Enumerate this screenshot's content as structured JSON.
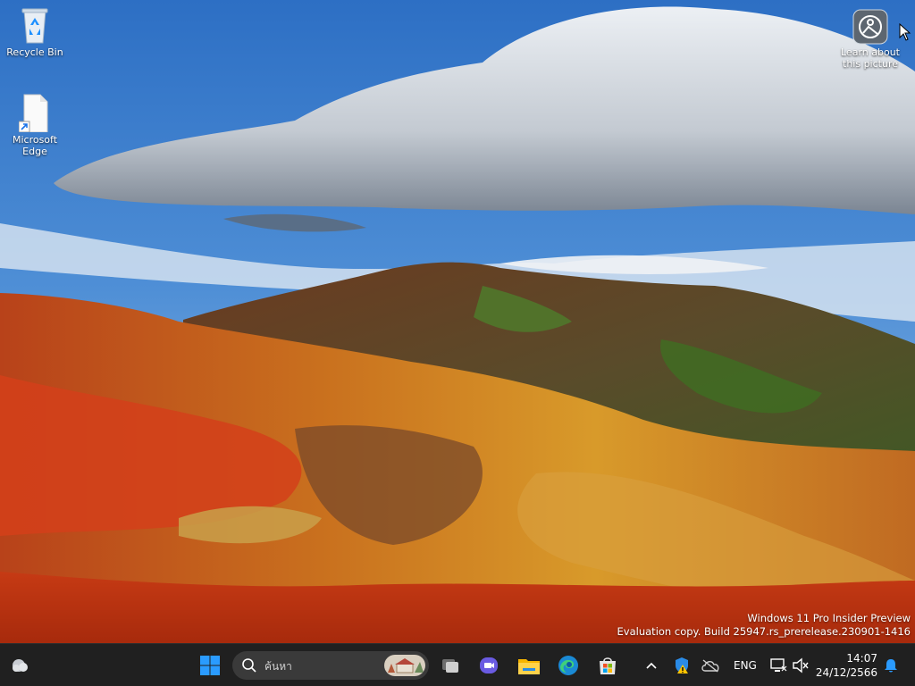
{
  "desktop": {
    "icons": [
      {
        "label": "Recycle Bin",
        "icon": "recycle-bin-icon"
      },
      {
        "label": "Microsoft\nEdge",
        "icon": "edge-shortcut-icon"
      }
    ],
    "spotlight": {
      "label": "Learn about\nthis picture",
      "icon": "spotlight-camera-icon"
    }
  },
  "watermark": {
    "line1": "Windows 11 Pro Insider Preview",
    "line2": "Evaluation copy. Build 25947.rs_prerelease.230901-1416"
  },
  "taskbar": {
    "search_placeholder": "ค้นหา",
    "pinned": [
      "start-icon",
      "task-view-icon",
      "meet-icon",
      "file-explorer-icon",
      "edge-icon",
      "store-icon"
    ],
    "tray": {
      "language": "ENG",
      "time": "14:07",
      "date": "24/12/2566"
    }
  },
  "colors": {
    "taskbar": "#202020",
    "search": "#3a3a3a",
    "start_blue": "#1e90ff"
  }
}
